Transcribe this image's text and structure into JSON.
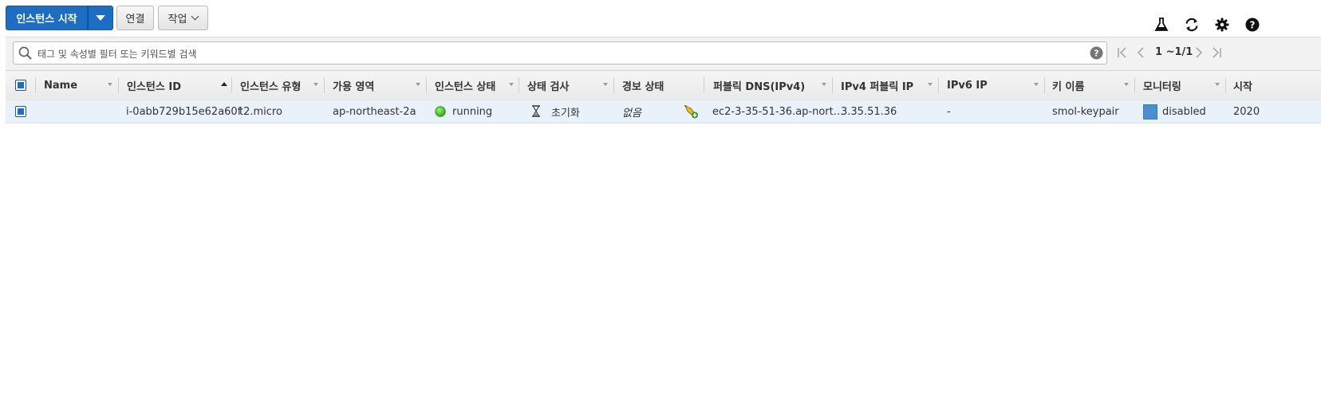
{
  "toolbar": {
    "launch_label": "인스턴스 시작",
    "connect_label": "연결",
    "actions_label": "작업"
  },
  "search": {
    "placeholder": "태그 및 속성별 필터 또는 키워드별 검색"
  },
  "pagination": {
    "label": "1 ~1/1"
  },
  "table": {
    "columns": [
      "Name",
      "인스턴스 ID",
      "인스턴스 유형",
      "가용 영역",
      "인스턴스 상태",
      "상태 검사",
      "경보 상태",
      "퍼블릭 DNS(IPv4)",
      "IPv4 퍼블릭 IP",
      "IPv6 IP",
      "키 이름",
      "모니터링",
      "시작"
    ],
    "rows": [
      {
        "name": "",
        "instance_id": "i-0abb729b15e62a60f",
        "instance_type": "t2.micro",
        "availability_zone": "ap-northeast-2a",
        "instance_state": "running",
        "status_check": "초기화",
        "alarm_status": "없음",
        "public_dns": "ec2-3-35-51-36.ap-nort…",
        "public_ip": "3.35.51.36",
        "ipv6_ip": "-",
        "key_name": "smol-keypair",
        "monitoring": "disabled",
        "launch_time": "2020"
      }
    ]
  },
  "colors": {
    "primary": "#1b6ec2",
    "running": "#3cbf1e",
    "row_selected": "#e9f2fb",
    "monitoring_swatch": "#4a90d0"
  }
}
